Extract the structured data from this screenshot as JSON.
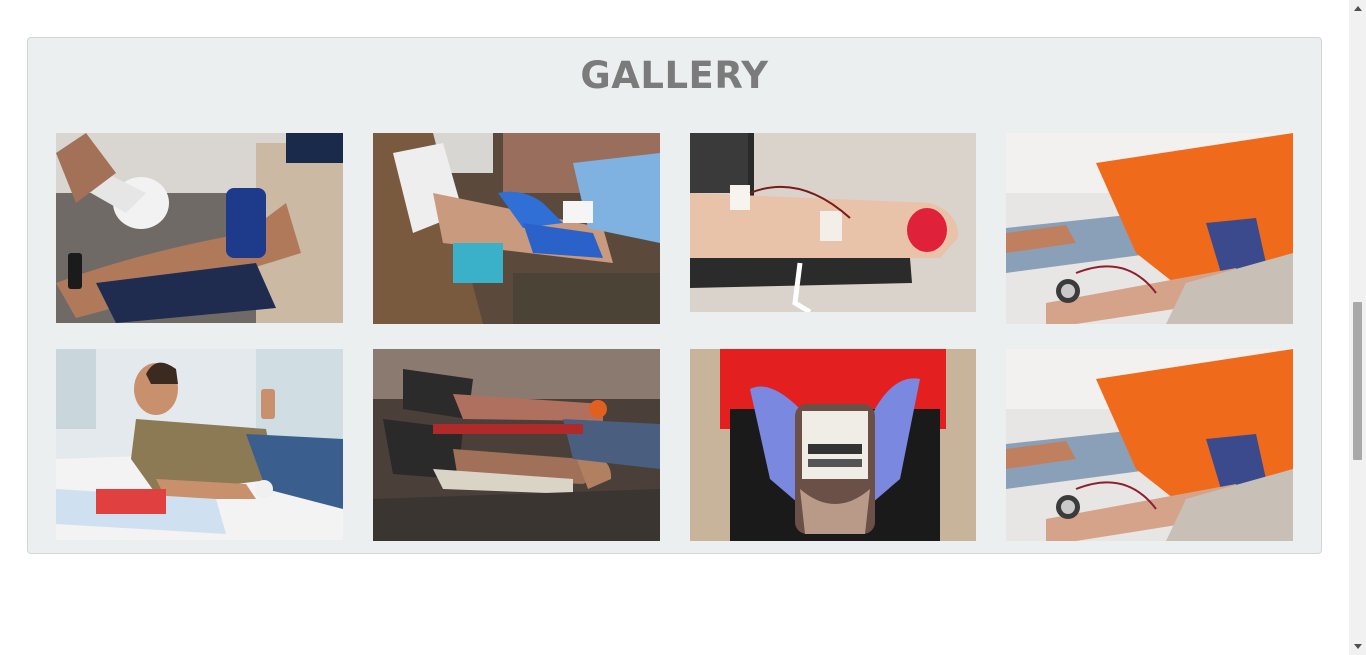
{
  "gallery": {
    "title": "GALLERY",
    "images": [
      {
        "id": "photo-1",
        "subject": "arm-tourniquet-gloved-hand"
      },
      {
        "id": "photo-2",
        "subject": "blood-pressure-cuff-arm"
      },
      {
        "id": "photo-3",
        "subject": "arm-squeezing-red-ball"
      },
      {
        "id": "photo-4",
        "subject": "donor-orange-shirt-arm"
      },
      {
        "id": "photo-5",
        "subject": "man-thumbs-up-on-bed"
      },
      {
        "id": "photo-6",
        "subject": "donors-with-cuffs"
      },
      {
        "id": "photo-7",
        "subject": "hands-holding-blood-bag"
      },
      {
        "id": "photo-8",
        "subject": "donor-orange-shirt-arm"
      }
    ]
  },
  "colors": {
    "panel_bg": "#eceff0",
    "title": "#7b7b7b"
  }
}
